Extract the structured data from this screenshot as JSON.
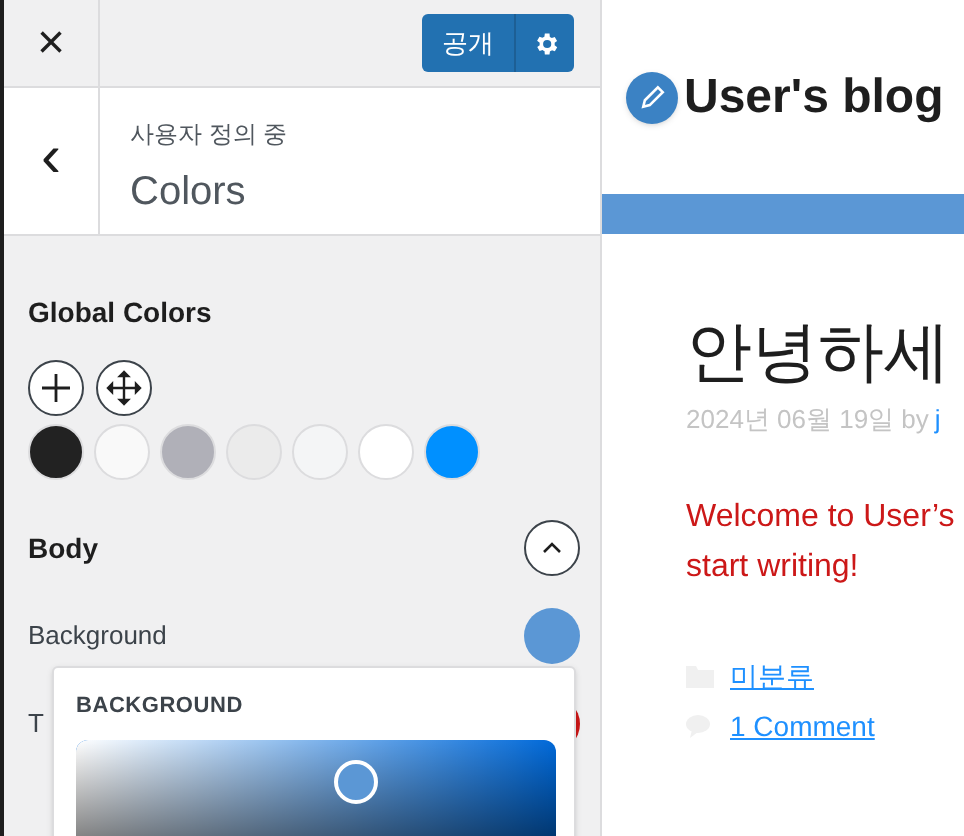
{
  "header": {
    "close": "×",
    "publish_button": "공개"
  },
  "section_header": {
    "back": "‹",
    "subtitle": "사용자 정의 중",
    "title": "Colors"
  },
  "global_colors": {
    "title": "Global Colors",
    "swatches": [
      {
        "color": "#222222"
      },
      {
        "color": "#f9f9f9"
      },
      {
        "color": "#b0b0b8"
      },
      {
        "color": "#ebebeb"
      },
      {
        "color": "#f4f5f6"
      },
      {
        "color": "#ffffff"
      },
      {
        "color": "#0090ff"
      }
    ]
  },
  "body_section": {
    "title": "Body",
    "expanded": true,
    "rows": [
      {
        "label": "Background",
        "color": "#5b97d5"
      },
      {
        "label": "T",
        "color": "#cc1818"
      }
    ]
  },
  "color_picker": {
    "title": "BACKGROUND"
  },
  "preview": {
    "site_title": "User's blog",
    "post_title": "안녕하세",
    "date": "2024년 06월 19일 by",
    "author": "j",
    "excerpt": "Welcome to User’s start writing!",
    "category": "미분류",
    "comments": "1 Comment"
  }
}
